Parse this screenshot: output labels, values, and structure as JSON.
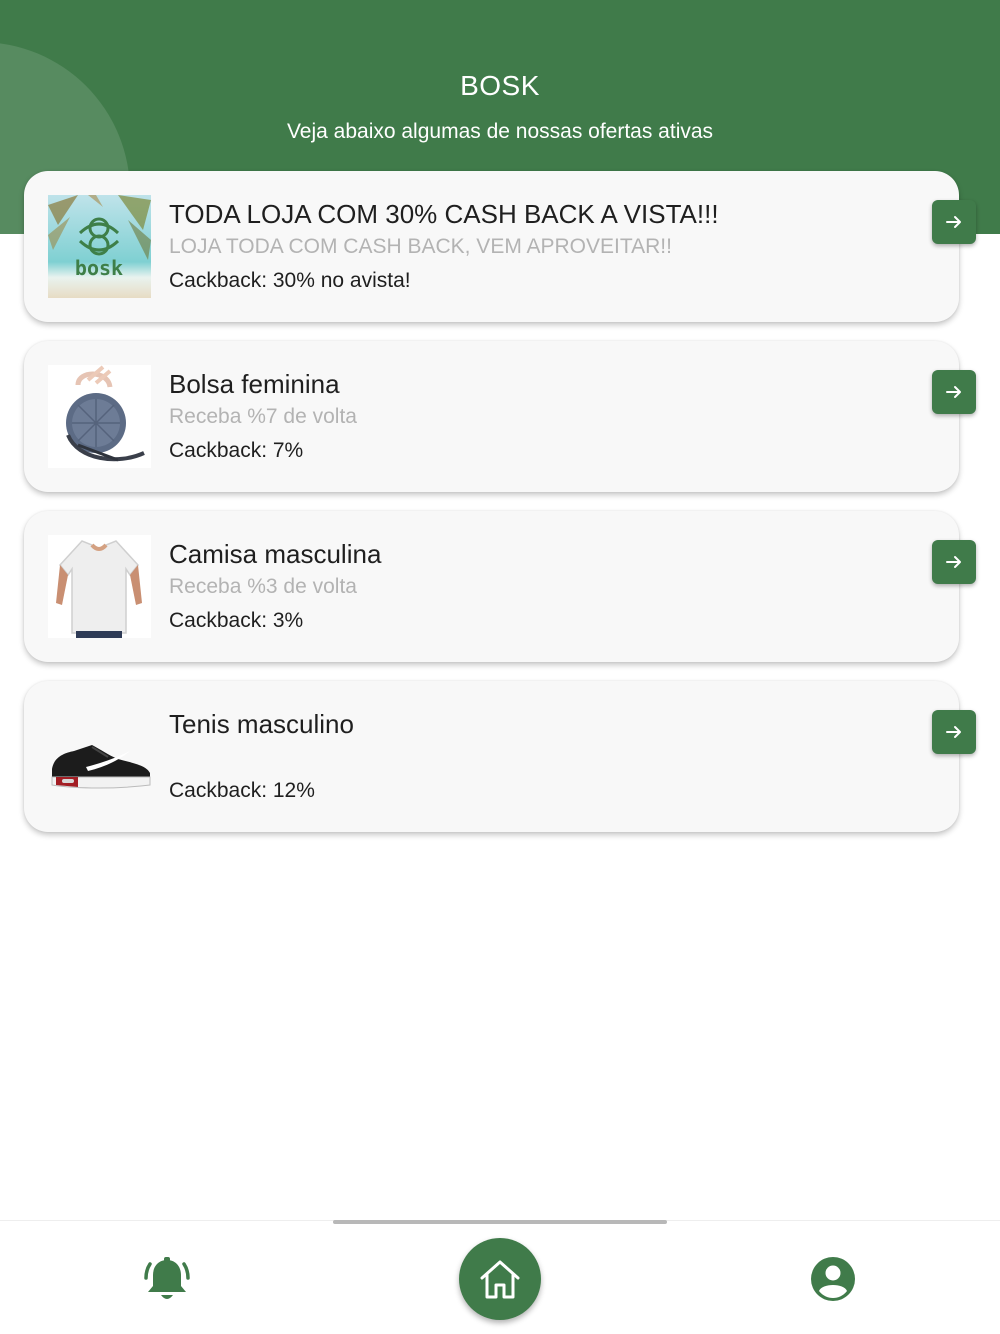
{
  "header": {
    "title": "BOSK",
    "subtitle": "Veja abaixo algumas de nossas ofertas ativas"
  },
  "offers": [
    {
      "title": "TODA LOJA COM 30% CASH BACK A VISTA!!!",
      "description": "LOJA TODA COM CASH BACK, VEM APROVEITAR!!",
      "cashback": "Cackback: 30% no avista!",
      "image": "bosk-logo-beach",
      "logo_text": "bosk"
    },
    {
      "title": "Bolsa feminina",
      "description": "Receba %7 de volta",
      "cashback": "Cackback: 7%",
      "image": "handbag"
    },
    {
      "title": "Camisa masculina",
      "description": "Receba %3 de volta",
      "cashback": "Cackback: 3%",
      "image": "white-tshirt"
    },
    {
      "title": "Tenis masculino",
      "description": "",
      "cashback": "Cackback: 12%",
      "image": "sneaker"
    }
  ],
  "nav": {
    "left_icon": "bell-icon",
    "center_icon": "home-icon",
    "right_icon": "user-icon"
  },
  "colors": {
    "brand_green": "#407b4a",
    "card_bg": "#f8f8f8",
    "muted_text": "#b3b3b3"
  }
}
